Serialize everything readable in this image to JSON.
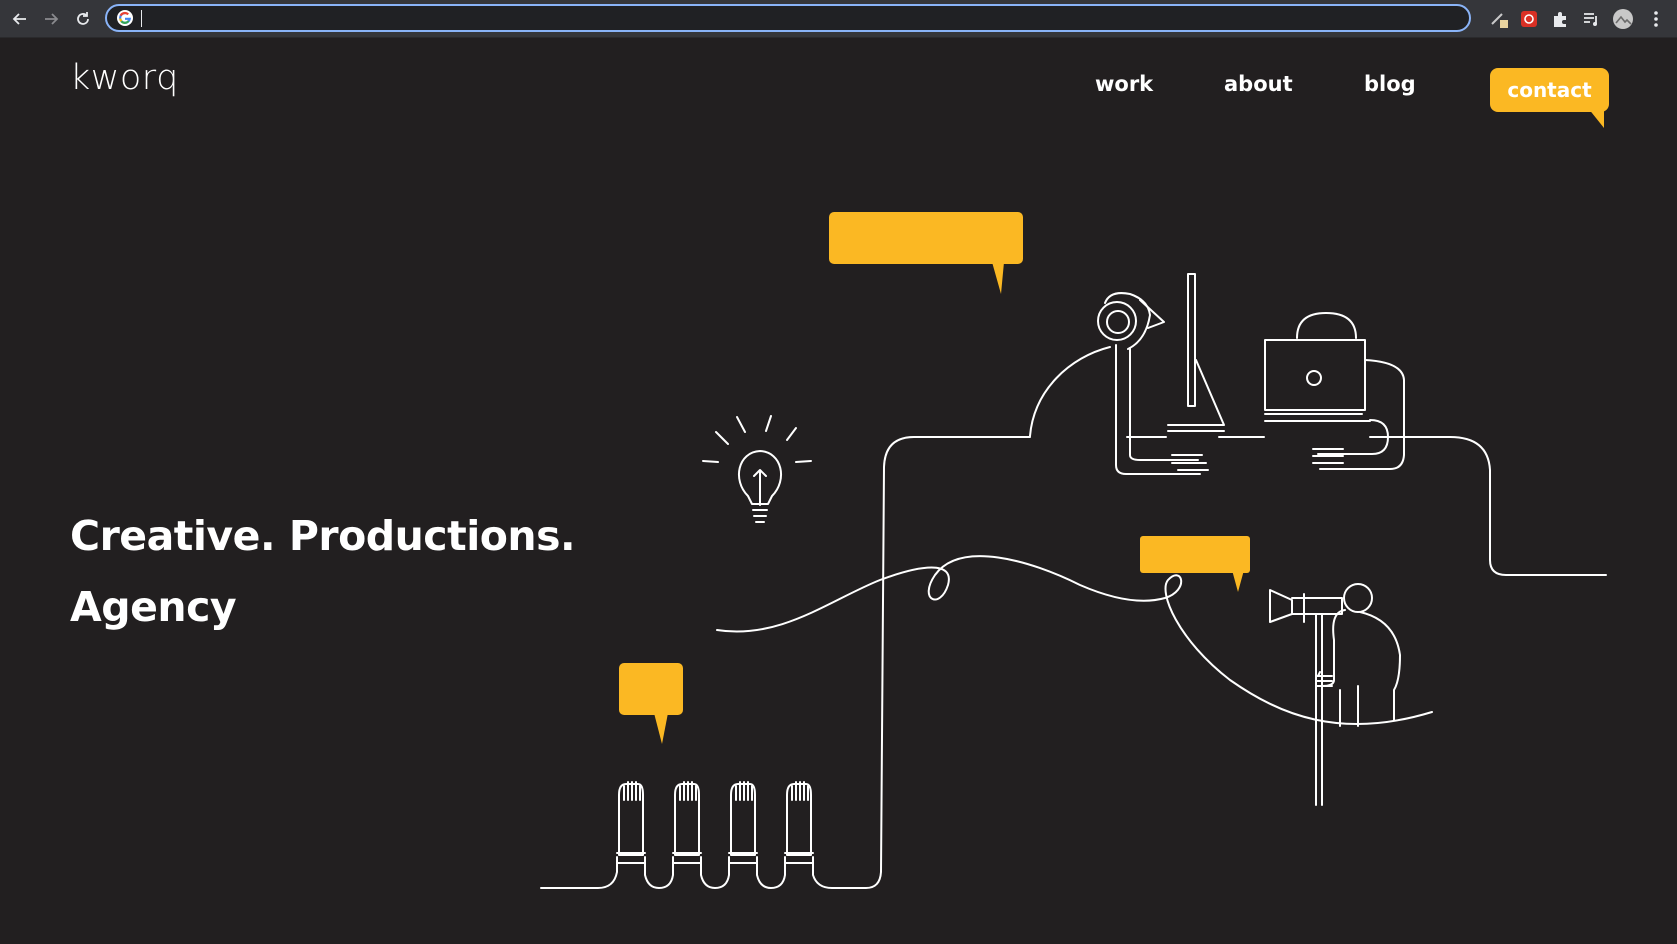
{
  "browser": {
    "address_value": "",
    "icons": [
      "back-arrow-icon",
      "forward-arrow-icon",
      "reload-icon",
      "google-icon",
      "pencil-extension-icon",
      "red-extension-icon",
      "puzzle-extension-icon",
      "playlist-icon",
      "profile-avatar-icon",
      "kebab-menu-icon"
    ]
  },
  "site": {
    "logo": "kworq",
    "nav": {
      "work": "work",
      "about": "about",
      "blog": "blog",
      "contact": "contact"
    },
    "hero": {
      "line1": "Creative. Productions.",
      "line2": "Agency"
    }
  },
  "colors": {
    "background": "#221f20",
    "accent": "#fbb823",
    "line": "#ffffff"
  }
}
